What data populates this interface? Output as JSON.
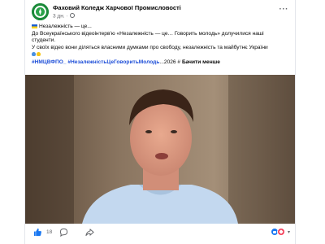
{
  "post": {
    "page_name": "Фаховий Коледж Харчової Промисловості",
    "time": "3 дн.",
    "separator": "·",
    "line1": "Незалежність — це...",
    "line2": "До Всеукраїнського відеоінтерв'ю «Незалежність — це… Говорить молодь» долучилися наші",
    "line3": "студенти.",
    "line4": "У своїх відео вони діляться власними думками про свободу, незалежність та майбутнє України",
    "hashtag1": "#НМЦВФПО_",
    "hashtag2": "#НезалежністьЦеГоворитьМолодь",
    "hashtag_tail": "...2026 #",
    "see_less": "Бачити менше"
  },
  "footer": {
    "likes": "18",
    "comments": "",
    "shares": ""
  },
  "icons": {
    "avatar": "college-logo-icon",
    "globe": "globe-icon",
    "more": "more-options-icon",
    "like": "thumbs-up-icon",
    "comment": "comment-icon",
    "share": "share-icon"
  },
  "colors": {
    "accent": "#1877f2",
    "hashtag": "#1d4ed8",
    "logo_green": "#1b8a3a",
    "text": "#050505",
    "muted": "#65676b"
  }
}
